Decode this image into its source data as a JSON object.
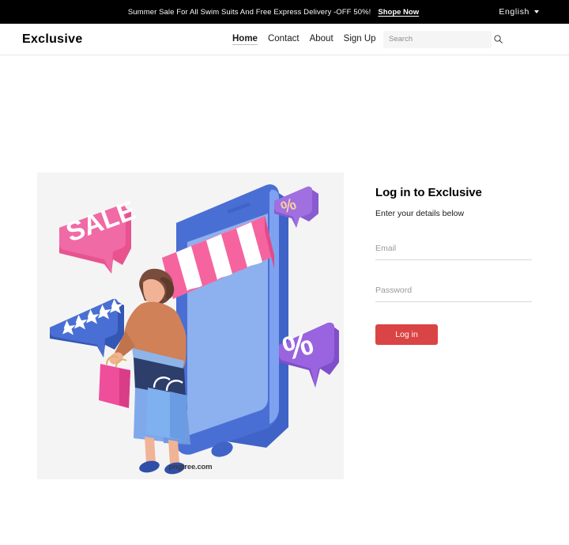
{
  "announcement": {
    "message": "Summer Sale For All Swim Suits And Free Express Delivery -OFF 50%!",
    "link_label": "Shope Now",
    "language": "English",
    "language_caret_icon": "chevron-down-icon",
    "background_color": "#000000"
  },
  "header": {
    "logo": "Exclusive",
    "nav": [
      {
        "label": "Home",
        "active": true
      },
      {
        "label": "Contact",
        "active": false
      },
      {
        "label": "About",
        "active": false
      },
      {
        "label": "Sign Up",
        "active": false
      }
    ],
    "search": {
      "placeholder": "Search",
      "value": "",
      "icon": "search-icon"
    }
  },
  "hero": {
    "watermark": "pngtree.com",
    "sale_label": "SALE",
    "percent_badge_large": "%",
    "percent_badge_small": "%",
    "star_count": 5,
    "background_color": "#f4f4f4",
    "phone_color": "#4a6fd4",
    "awning_color": "#f05a97"
  },
  "login": {
    "title": "Log in to Exclusive",
    "subtitle": "Enter your details below",
    "email": {
      "placeholder": "Email",
      "value": ""
    },
    "password": {
      "placeholder": "Password",
      "value": ""
    },
    "submit_label": "Log in",
    "accent_color": "#db4444"
  }
}
